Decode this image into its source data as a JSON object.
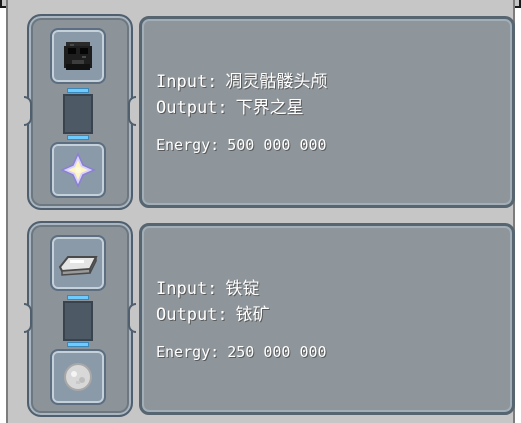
{
  "recipes": [
    {
      "input_label": "Input:",
      "input_value": "凋灵骷髅头颅",
      "output_label": "Output:",
      "output_value": "下界之星",
      "energy_label": "Energy:",
      "energy_value": "500 000 000",
      "input_icon": "wither-skeleton-skull-icon",
      "output_icon": "nether-star-icon"
    },
    {
      "input_label": "Input:",
      "input_value": "铁锭",
      "output_label": "Output:",
      "output_value": "铱矿",
      "energy_label": "Energy:",
      "energy_value": "250 000 000",
      "input_icon": "iron-ingot-icon",
      "output_icon": "iridium-ore-icon"
    }
  ],
  "colors": {
    "panel_bg": "#8e969c",
    "panel_border": "#566570",
    "connector_glow": "#6ecbff",
    "text": "#ffffff"
  }
}
